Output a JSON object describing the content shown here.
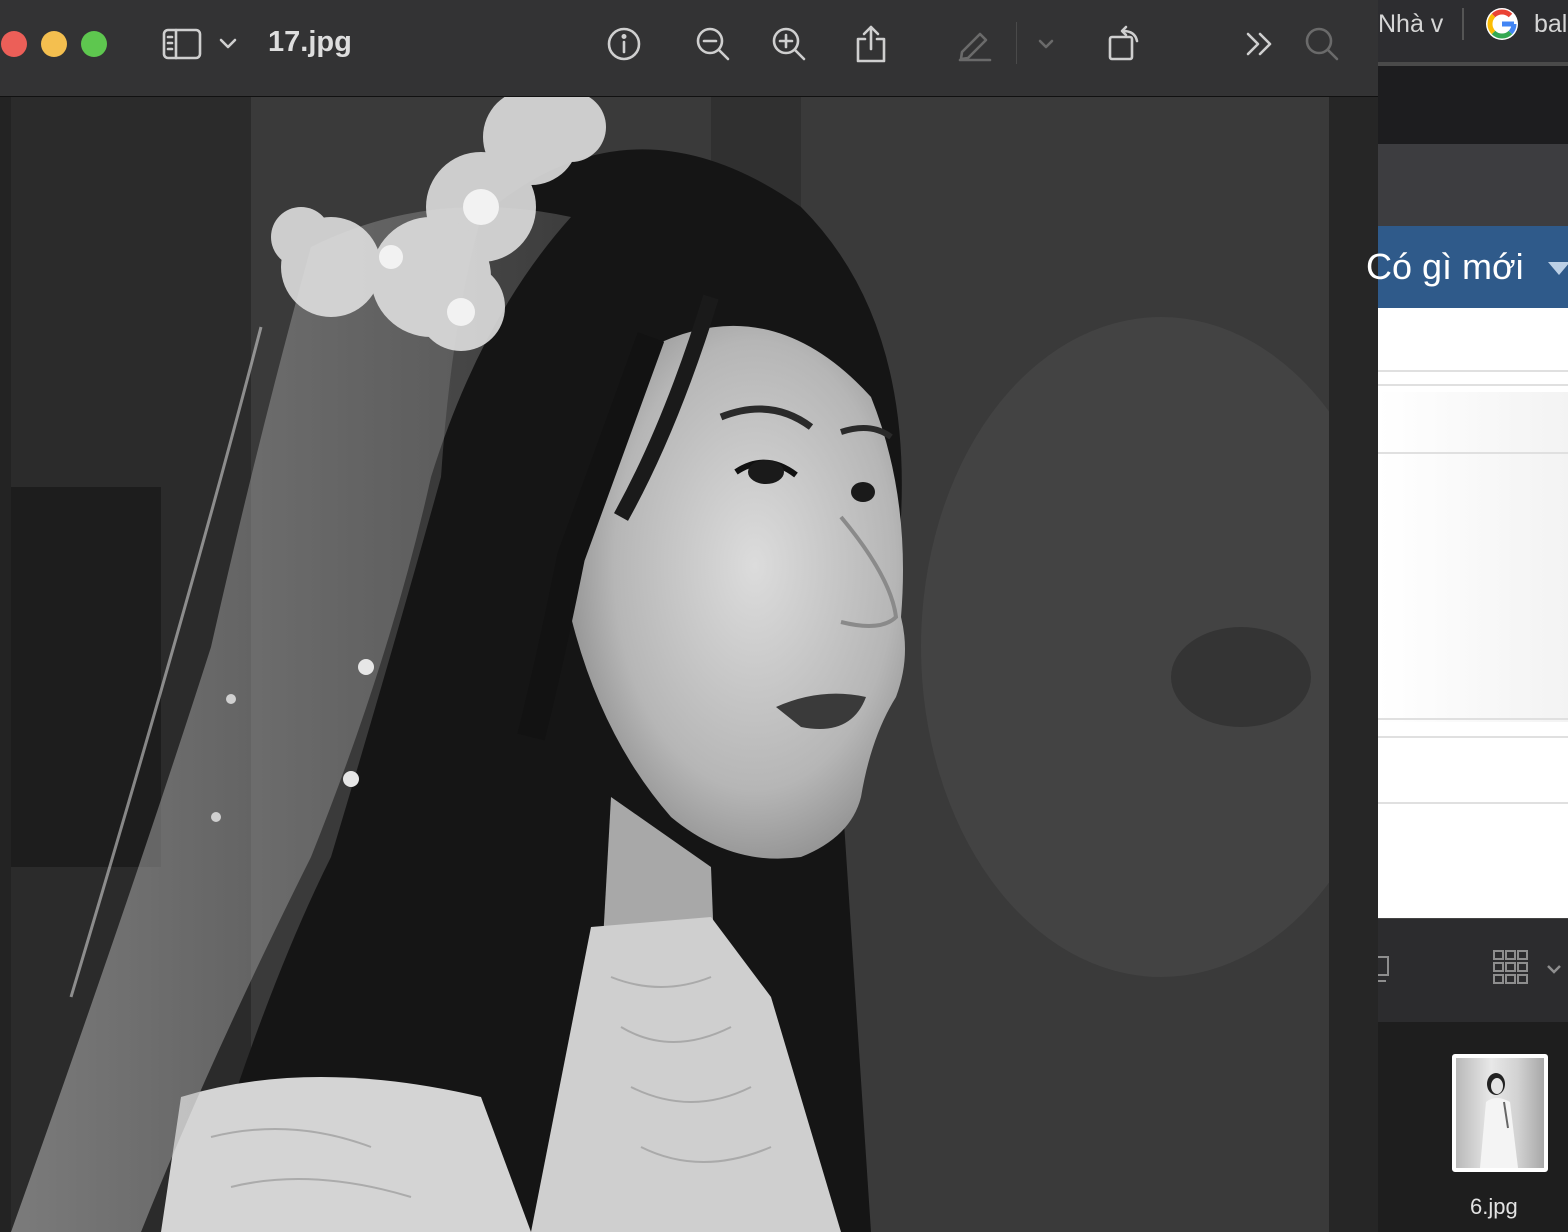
{
  "window": {
    "title": "17.jpg",
    "toolbar_icons": [
      "sidebar-icon",
      "chevron-down-icon",
      "info-icon",
      "zoom-out-icon",
      "zoom-in-icon",
      "share-icon",
      "markup-pen-icon",
      "chevron-down-icon",
      "rotate-icon",
      "more-chevrons-icon",
      "search-icon"
    ]
  },
  "background_app": {
    "bookmark_1": "Nhà v",
    "bookmark_2": "bal",
    "header_label": "Có gì mới",
    "file_label": "6.jpg"
  },
  "colors": {
    "titlebar": "#333334",
    "traffic_red": "#ec5f58",
    "traffic_yellow": "#f4bf4f",
    "traffic_green": "#5ec74f",
    "header_blue": "#2f5a8a"
  }
}
